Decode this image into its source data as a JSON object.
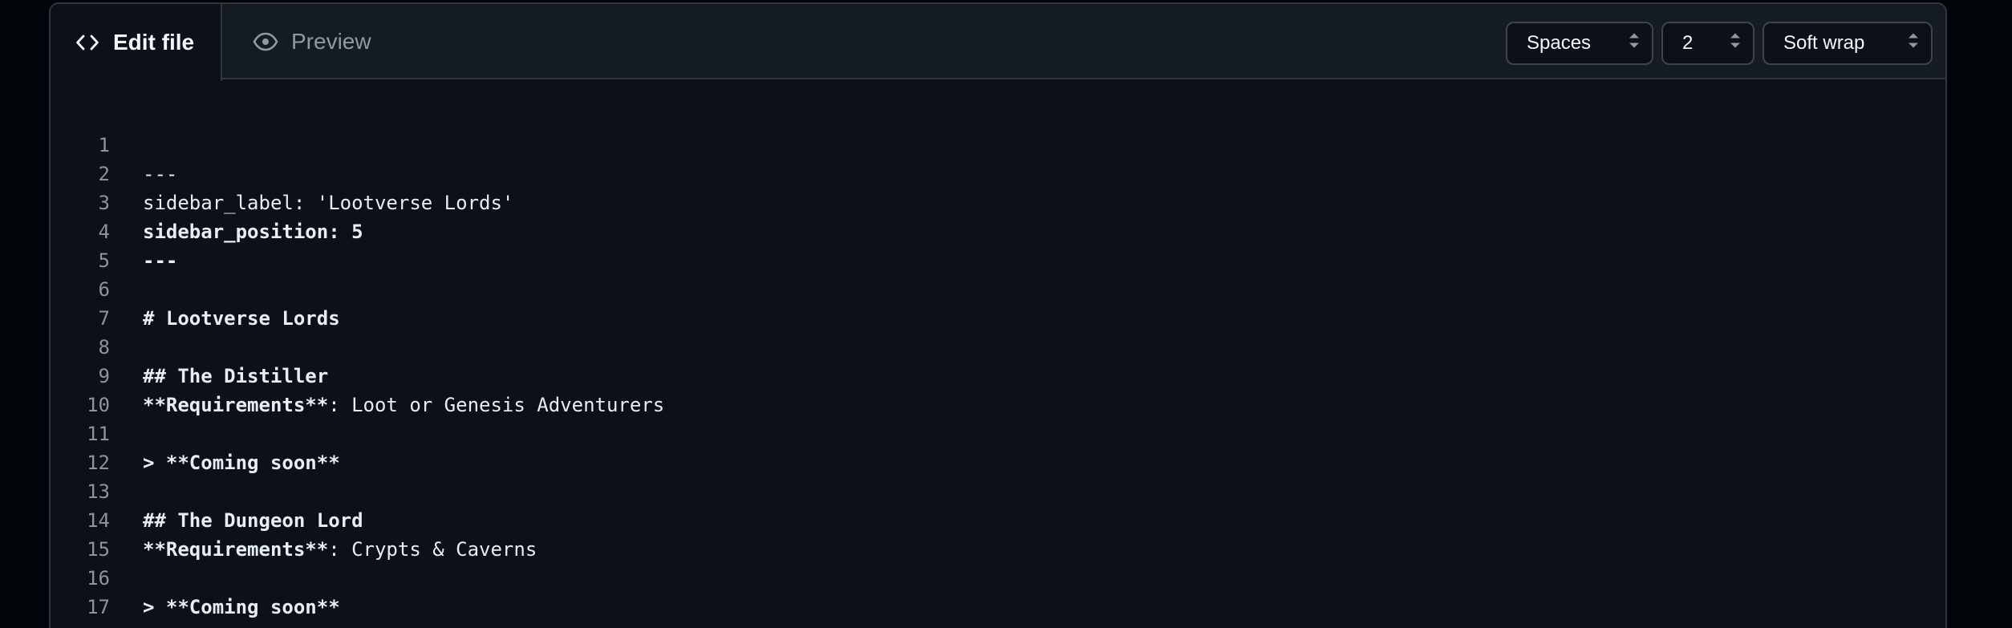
{
  "tabs": {
    "edit_label": "Edit file",
    "preview_label": "Preview"
  },
  "controls": {
    "indent_mode": "Spaces",
    "indent_size": "2",
    "wrap_mode": "Soft wrap"
  },
  "icons": {
    "edit": "code-icon",
    "preview": "eye-icon",
    "select": "chevron-up-down-icon"
  },
  "colors": {
    "background": "#0d1117",
    "header": "#151b23",
    "border": "#30363d",
    "text": "#e6edf3",
    "line_number": "#8b949e"
  },
  "lines": [
    {
      "num": "1",
      "text": "---",
      "bold": false
    },
    {
      "num": "2",
      "text": "sidebar_label: 'Lootverse Lords'",
      "bold": false
    },
    {
      "num": "3",
      "text": "sidebar_position: 5",
      "bold": true
    },
    {
      "num": "4",
      "text": "---",
      "bold": true
    },
    {
      "num": "5",
      "text": "",
      "bold": false
    },
    {
      "num": "6",
      "text": "# Lootverse Lords",
      "bold": true
    },
    {
      "num": "7",
      "text": "",
      "bold": false
    },
    {
      "num": "8",
      "text": "## The Distiller",
      "bold": true
    },
    {
      "num": "9",
      "text_bold": "**Requirements**",
      "text": ": Loot or Genesis Adventurers",
      "bold": false
    },
    {
      "num": "10",
      "text": "",
      "bold": false
    },
    {
      "num": "11",
      "text": "> **Coming soon**",
      "bold": true
    },
    {
      "num": "12",
      "text": "",
      "bold": false
    },
    {
      "num": "13",
      "text": "## The Dungeon Lord",
      "bold": true
    },
    {
      "num": "14",
      "text_bold": "**Requirements**",
      "text": ": Crypts & Caverns",
      "bold": false
    },
    {
      "num": "15",
      "text": "",
      "bold": false
    },
    {
      "num": "16",
      "text": "> **Coming soon**",
      "bold": true
    },
    {
      "num": "17",
      "text": "",
      "bold": false
    }
  ]
}
